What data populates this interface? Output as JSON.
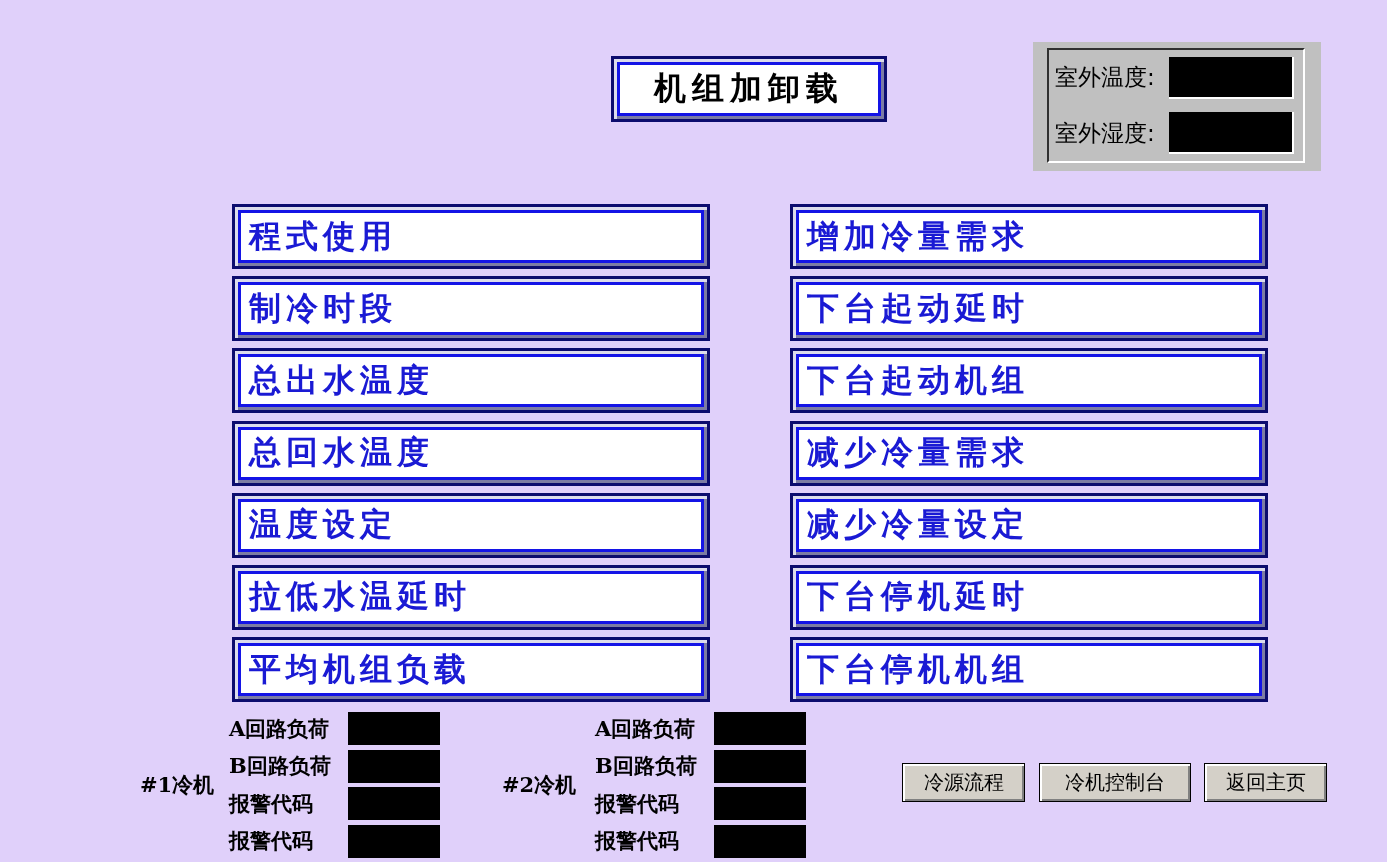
{
  "title": "机组加卸载",
  "outdoor_panel": {
    "readings": [
      {
        "label": "室外温度:"
      },
      {
        "label": "室外湿度:"
      }
    ]
  },
  "menu": {
    "left": [
      "程式使用",
      "制冷时段",
      "总出水温度",
      "总回水温度",
      "温度设定",
      "拉低水温延时",
      "平均机组负载"
    ],
    "right": [
      "增加冷量需求",
      "下台起动延时",
      "下台起动机组",
      "减少冷量需求",
      "减少冷量设定",
      "下台停机延时",
      "下台停机机组"
    ]
  },
  "chillers": [
    {
      "name": "#1冷机",
      "readings": [
        {
          "label": "A回路负荷"
        },
        {
          "label": "B回路负荷"
        },
        {
          "label": "报警代码"
        },
        {
          "label": "报警代码"
        }
      ]
    },
    {
      "name": "#2冷机",
      "readings": [
        {
          "label": "A回路负荷"
        },
        {
          "label": "B回路负荷"
        },
        {
          "label": "报警代码"
        },
        {
          "label": "报警代码"
        }
      ]
    }
  ],
  "nav_buttons": [
    "冷源流程",
    "冷机控制台",
    "返回主页"
  ]
}
